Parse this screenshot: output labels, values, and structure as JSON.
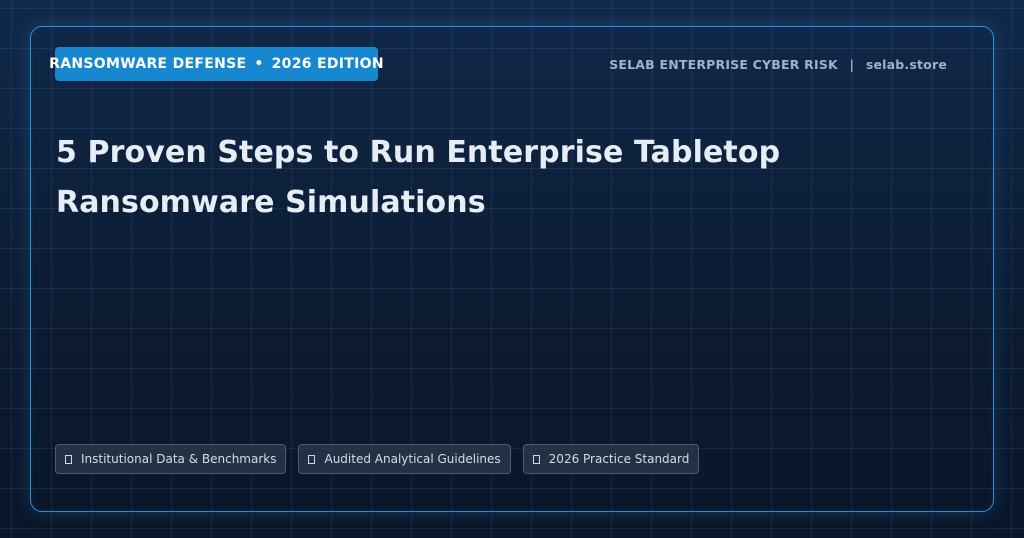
{
  "badge": {
    "left": "RANSOMWARE DEFENSE",
    "separator": "•",
    "right": "2026 EDITION"
  },
  "brand": {
    "name": "SELAB ENTERPRISE CYBER RISK",
    "separator": "|",
    "site": "selab.store"
  },
  "title": "5 Proven Steps to Run Enterprise Tabletop Ransomware Simulations",
  "chips": [
    {
      "label": "Institutional Data & Benchmarks",
      "icon": "missing-glyph-icon"
    },
    {
      "label": "Audited Analytical Guidelines",
      "icon": "missing-glyph-icon"
    },
    {
      "label": "2026 Practice Standard",
      "icon": "missing-glyph-icon"
    }
  ],
  "colors": {
    "background": "#0d2036",
    "frame_border": "#2f8fda",
    "badge_background": "#1787d0",
    "title_text": "#e6edf4",
    "brand_text": "#9fb3c7"
  }
}
